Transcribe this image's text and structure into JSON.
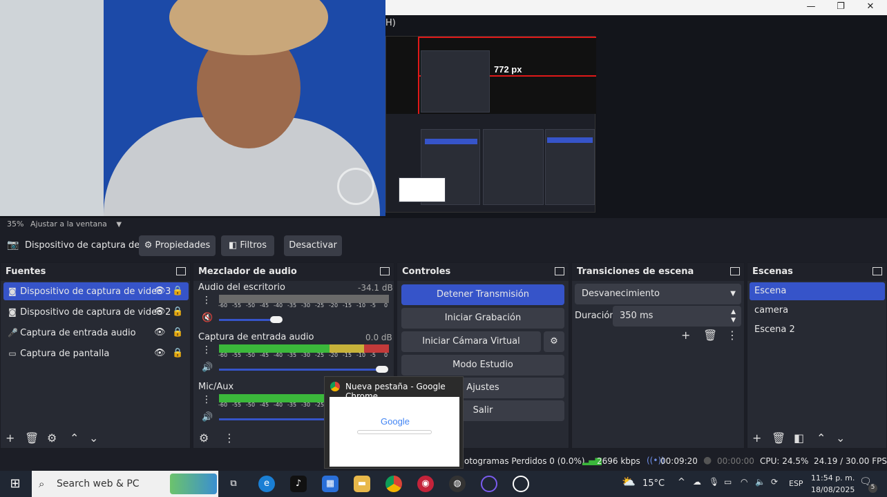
{
  "window": {
    "menu_fragment": "H)",
    "minimize_icon": "minimize-icon",
    "maximize_icon": "restore-icon",
    "close_icon": "close-icon"
  },
  "preview": {
    "zoom": "35%",
    "fit_label": "Ajustar a la ventana",
    "mini_width_label": "772 px"
  },
  "source_toolbar": {
    "source_name": "Dispositivo de captura de v",
    "properties_label": "Propiedades",
    "filters_label": "Filtros",
    "deactivate_label": "Desactivar"
  },
  "sources": {
    "title": "Fuentes",
    "items": [
      {
        "label": "Dispositivo de captura de video 3",
        "icon": "camera-icon",
        "selected": true
      },
      {
        "label": "Dispositivo de captura de video 2",
        "icon": "camera-icon",
        "selected": false
      },
      {
        "label": "Captura de entrada audio",
        "icon": "microphone-icon",
        "selected": false
      },
      {
        "label": "Captura de pantalla",
        "icon": "monitor-icon",
        "selected": false
      }
    ]
  },
  "mixer": {
    "title": "Mezclador de audio",
    "channels": [
      {
        "name": "Audio del escritorio",
        "db": "-34.1 dB",
        "volume": 0.48,
        "muted": true
      },
      {
        "name": "Captura de entrada audio",
        "db": "0.0 dB",
        "volume": 1.0,
        "muted": false
      },
      {
        "name": "Mic/Aux",
        "db": "",
        "volume": 1.0,
        "muted": false
      }
    ],
    "scale": [
      "-60",
      "-55",
      "-50",
      "-45",
      "-40",
      "-35",
      "-30",
      "-25",
      "-20",
      "-15",
      "-10",
      "-5",
      "0"
    ]
  },
  "controls": {
    "title": "Controles",
    "stop_stream": "Detener Transmisión",
    "start_record": "Iniciar Grabación",
    "start_vcam": "Iniciar Cámara Virtual",
    "studio_mode": "Modo Estudio",
    "settings": "Ajustes",
    "exit": "Salir"
  },
  "transitions": {
    "title": "Transiciones de escena",
    "selected": "Desvanecimiento",
    "duration_label": "Duración",
    "duration_value": "350 ms"
  },
  "scenes": {
    "title": "Escenas",
    "items": [
      {
        "label": "Escena",
        "selected": true
      },
      {
        "label": "camera",
        "selected": false
      },
      {
        "label": "Escena 2",
        "selected": false
      }
    ]
  },
  "chrome_popup": {
    "title": "Nueva pestaña - Google Chrome",
    "logo_text": "Google"
  },
  "status": {
    "dropped": "otogramas Perdidos 0 (0.0%)",
    "bitrate": "2696 kbps",
    "stream_time": "00:09:20",
    "record_time": "00:00:00",
    "cpu": "CPU: 24.5%",
    "fps": "24.19 / 30.00 FPS"
  },
  "taskbar": {
    "search_placeholder": "Search web & PC",
    "weather": "15°C",
    "language": "ESP",
    "time": "11:54 p. m.",
    "date": "18/08/2025",
    "notif_count": "5"
  },
  "colors": {
    "accent": "#3654c9",
    "panel": "#272a33",
    "meter_green": "#3bb83b",
    "meter_yellow": "#c7b23a",
    "meter_red": "#c23a3a"
  }
}
